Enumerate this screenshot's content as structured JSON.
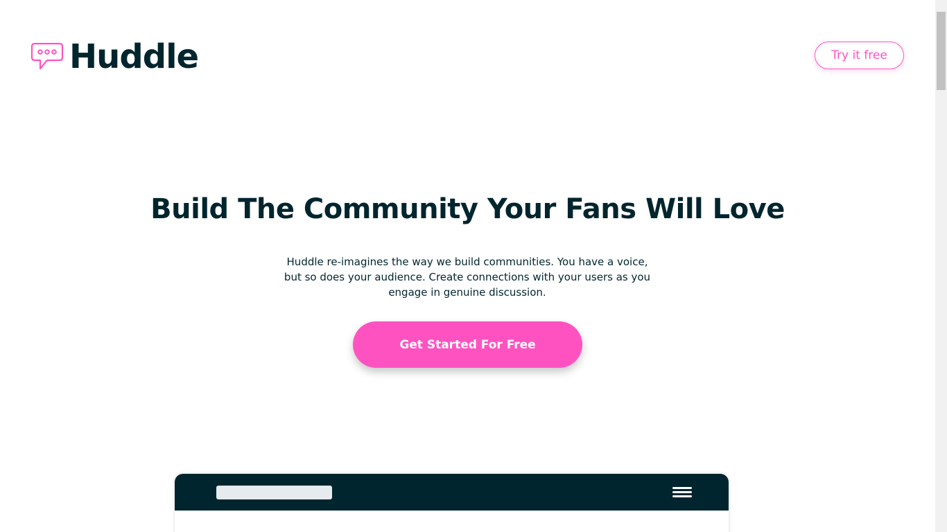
{
  "header": {
    "logo_text": "Huddle",
    "logo_icon": "chat-bubble-icon",
    "try_button": "Try it free"
  },
  "hero": {
    "title": "Build The Community Your Fans Will Love",
    "description": "Huddle re-imagines the way we build communities. You have a voice, but so does your audience. Create connections with your users as you engage in genuine discussion.",
    "cta_button": "Get Started For Free"
  },
  "mockup": {
    "menu_icon": "hamburger-menu-icon"
  },
  "colors": {
    "accent": "#ff52c1",
    "dark": "#00252e",
    "mockup_search": "#e5ebef"
  }
}
